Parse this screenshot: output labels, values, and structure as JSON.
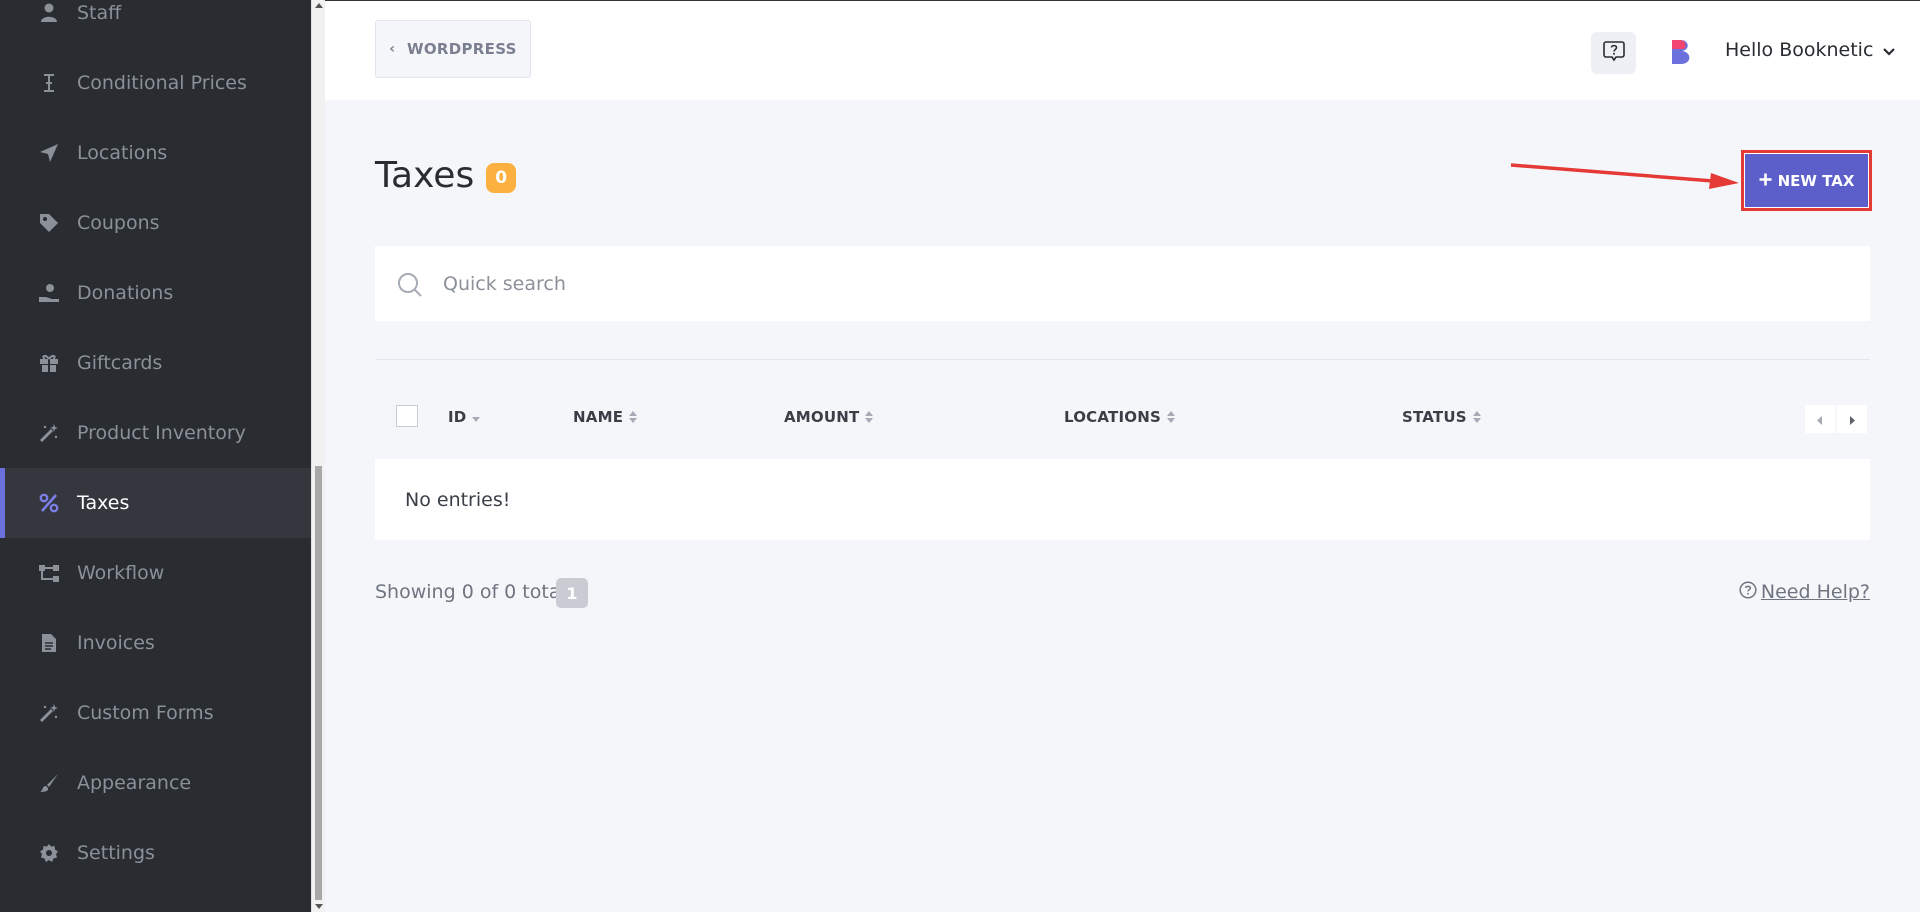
{
  "sidebar": {
    "items": [
      {
        "label": "Staff",
        "icon": "user-icon"
      },
      {
        "label": "Conditional Prices",
        "icon": "text-cursor-icon"
      },
      {
        "label": "Locations",
        "icon": "location-arrow-icon"
      },
      {
        "label": "Coupons",
        "icon": "tag-icon"
      },
      {
        "label": "Donations",
        "icon": "hand-donate-icon"
      },
      {
        "label": "Giftcards",
        "icon": "gift-icon"
      },
      {
        "label": "Product Inventory",
        "icon": "magic-wand-icon"
      },
      {
        "label": "Taxes",
        "icon": "percent-icon",
        "active": true
      },
      {
        "label": "Workflow",
        "icon": "workflow-icon"
      },
      {
        "label": "Invoices",
        "icon": "file-icon"
      },
      {
        "label": "Custom Forms",
        "icon": "magic-wand-icon"
      },
      {
        "label": "Appearance",
        "icon": "brush-icon"
      },
      {
        "label": "Settings",
        "icon": "gear-icon"
      }
    ]
  },
  "topbar": {
    "back_label": "WORDPRESS",
    "user_greeting": "Hello Booknetic"
  },
  "page": {
    "title": "Taxes",
    "count": "0",
    "new_button_label": "NEW TAX"
  },
  "search": {
    "placeholder": "Quick search",
    "value": ""
  },
  "table": {
    "columns": [
      "ID",
      "NAME",
      "AMOUNT",
      "LOCATIONS",
      "STATUS"
    ],
    "empty_text": "No entries!"
  },
  "footer": {
    "showing_text": "Showing 0 of 0 total",
    "page": "1",
    "help_label": "Need Help?"
  },
  "colors": {
    "sidebar_bg": "#292d32",
    "accent": "#6c70dc",
    "primary_button": "#5c5ec9",
    "badge": "#fbb040",
    "highlight": "#e53935"
  }
}
